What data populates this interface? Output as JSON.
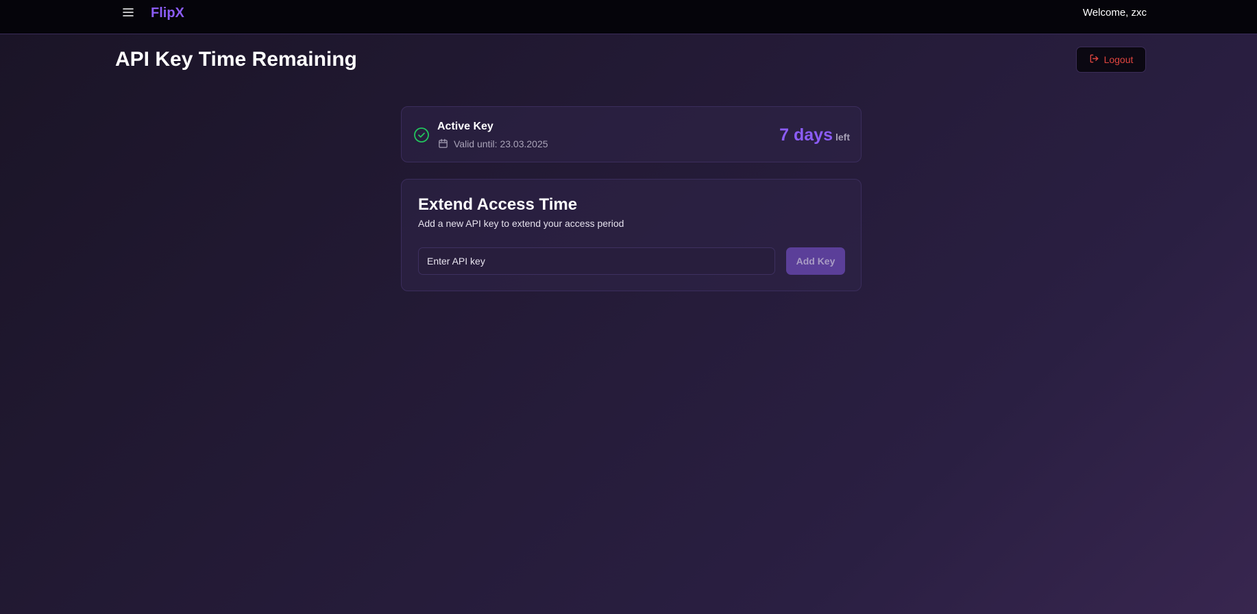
{
  "app": {
    "brand": "FlipX",
    "welcome": "Welcome, zxc",
    "accent_color": "#8b5cf6"
  },
  "header": {
    "menu_icon": "hamburger-menu-icon"
  },
  "page": {
    "title": "API Key Time Remaining",
    "logout_label": "Logout",
    "logout_icon": "logout-icon",
    "logout_color": "#e0453f"
  },
  "key_status": {
    "status_icon": "check-circle-icon",
    "status_color": "#22c55e",
    "title": "Active Key",
    "calendar_icon": "calendar-icon",
    "valid_until": "Valid until: 23.03.2025",
    "days_value": "7 days",
    "days_suffix": "left"
  },
  "extend": {
    "title": "Extend Access Time",
    "subtitle": "Add a new API key to extend your access period",
    "input_placeholder": "Enter API key",
    "input_value": "",
    "button_label": "Add Key"
  }
}
